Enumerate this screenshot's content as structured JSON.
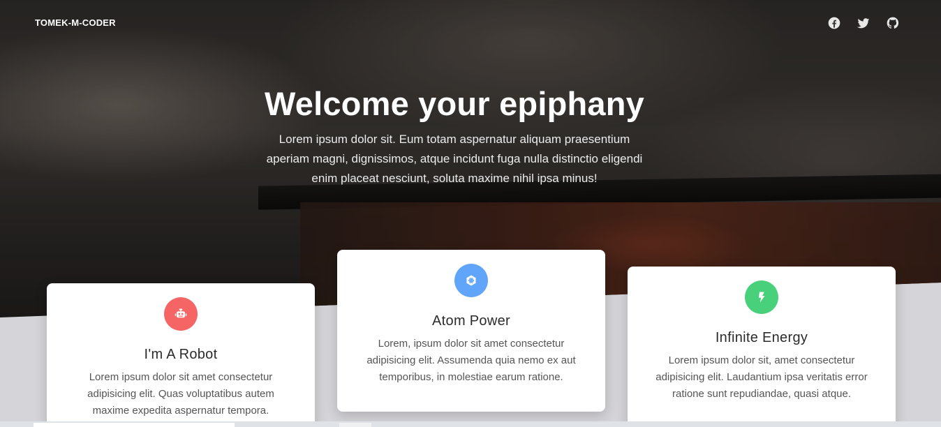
{
  "brand": "TOMEK-M-CODER",
  "socials": [
    {
      "icon": "facebook-icon"
    },
    {
      "icon": "twitter-icon"
    },
    {
      "icon": "github-icon"
    }
  ],
  "hero": {
    "title": "Welcome your epiphany",
    "subtitle": "Lorem ipsum dolor sit. Eum totam aspernatur aliquam praesentium aperiam magni, dignissimos, atque incidunt fuga nulla distinctio eligendi enim placeat nesciunt, soluta maxime nihil ipsa minus!"
  },
  "cards": [
    {
      "icon": "robot-icon",
      "color": "#f56565",
      "title": "I'm A Robot",
      "body": "Lorem ipsum dolor sit amet consectetur adipisicing elit. Quas voluptatibus autem maxime expedita aspernatur tempora."
    },
    {
      "icon": "atom-icon",
      "color": "#60a5fa",
      "title": "Atom Power",
      "body": "Lorem, ipsum dolor sit amet consectetur adipisicing elit. Assumenda quia nemo ex aut temporibus, in molestiae earum ratione."
    },
    {
      "icon": "bolt-icon",
      "color": "#48d17a",
      "title": "Infinite Energy",
      "body": "Lorem ipsum dolor sit, amet consectetur adipisicing elit. Laudantium ipsa veritatis error ratione sunt repudiandae, quasi atque."
    }
  ]
}
